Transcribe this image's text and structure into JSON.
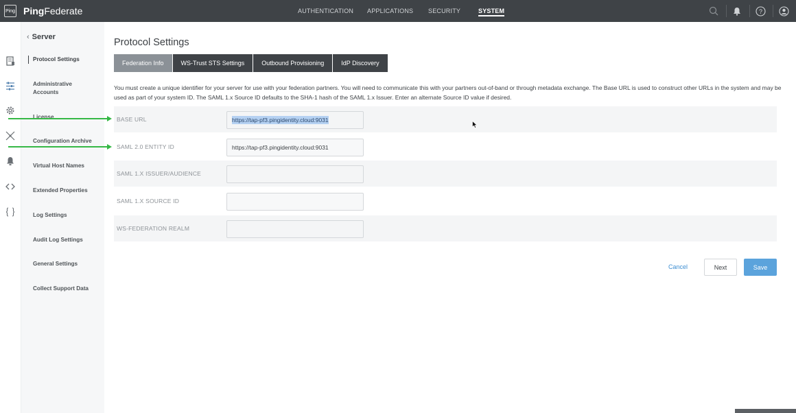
{
  "app": {
    "logo_text": "Ping",
    "brand_part1": "Ping",
    "brand_part2": "Federate"
  },
  "topnav": {
    "items": [
      {
        "label": "AUTHENTICATION",
        "active": false
      },
      {
        "label": "APPLICATIONS",
        "active": false
      },
      {
        "label": "SECURITY",
        "active": false
      },
      {
        "label": "SYSTEM",
        "active": true
      }
    ],
    "icons": [
      "search-icon",
      "bell-icon",
      "help-icon",
      "user-icon"
    ]
  },
  "rail_icons": [
    "database-icon",
    "sliders-icon",
    "gear-icon",
    "connections-icon",
    "shield-icon",
    "code-icon",
    "braces-icon"
  ],
  "sidenav": {
    "back_label": "Server",
    "items": [
      {
        "label": "Protocol Settings",
        "active": true
      },
      {
        "label": "Administrative Accounts",
        "active": false
      },
      {
        "label": "License",
        "active": false
      },
      {
        "label": "Configuration Archive",
        "active": false
      },
      {
        "label": "Virtual Host Names",
        "active": false
      },
      {
        "label": "Extended Properties",
        "active": false
      },
      {
        "label": "Log Settings",
        "active": false
      },
      {
        "label": "Audit Log Settings",
        "active": false
      },
      {
        "label": "General Settings",
        "active": false
      },
      {
        "label": "Collect Support Data",
        "active": false
      }
    ]
  },
  "main": {
    "title": "Protocol Settings",
    "tabs": [
      {
        "label": "Federation Info",
        "active": true
      },
      {
        "label": "WS-Trust STS Settings",
        "active": false
      },
      {
        "label": "Outbound Provisioning",
        "active": false
      },
      {
        "label": "IdP Discovery",
        "active": false
      }
    ],
    "description": "You must create a unique identifier for your server for use with your federation partners. You will need to communicate this with your partners out-of-band or through metadata exchange. The Base URL is used to construct other URLs in the system and may be used as part of your system ID. The SAML 1.x Source ID defaults to the SHA-1 hash of the SAML 1.x Issuer. Enter an alternate Source ID value if desired.",
    "fields": [
      {
        "label": "BASE URL",
        "value": "https://tap-pf3.pingidentity.cloud:9031",
        "selected": true
      },
      {
        "label": "SAML 2.0 ENTITY ID",
        "value": "https://tap-pf3.pingidentity.cloud:9031",
        "selected": false
      },
      {
        "label": "SAML 1.X ISSUER/AUDIENCE",
        "value": "",
        "selected": false
      },
      {
        "label": "SAML 1.X SOURCE ID",
        "value": "",
        "selected": false
      },
      {
        "label": "WS-FEDERATION REALM",
        "value": "",
        "selected": false
      }
    ],
    "buttons": {
      "cancel": "Cancel",
      "next": "Next",
      "save": "Save"
    }
  },
  "colors": {
    "topbar": "#3f4347",
    "save": "#5ba3dc",
    "annotation_arrow": "#35b845"
  }
}
